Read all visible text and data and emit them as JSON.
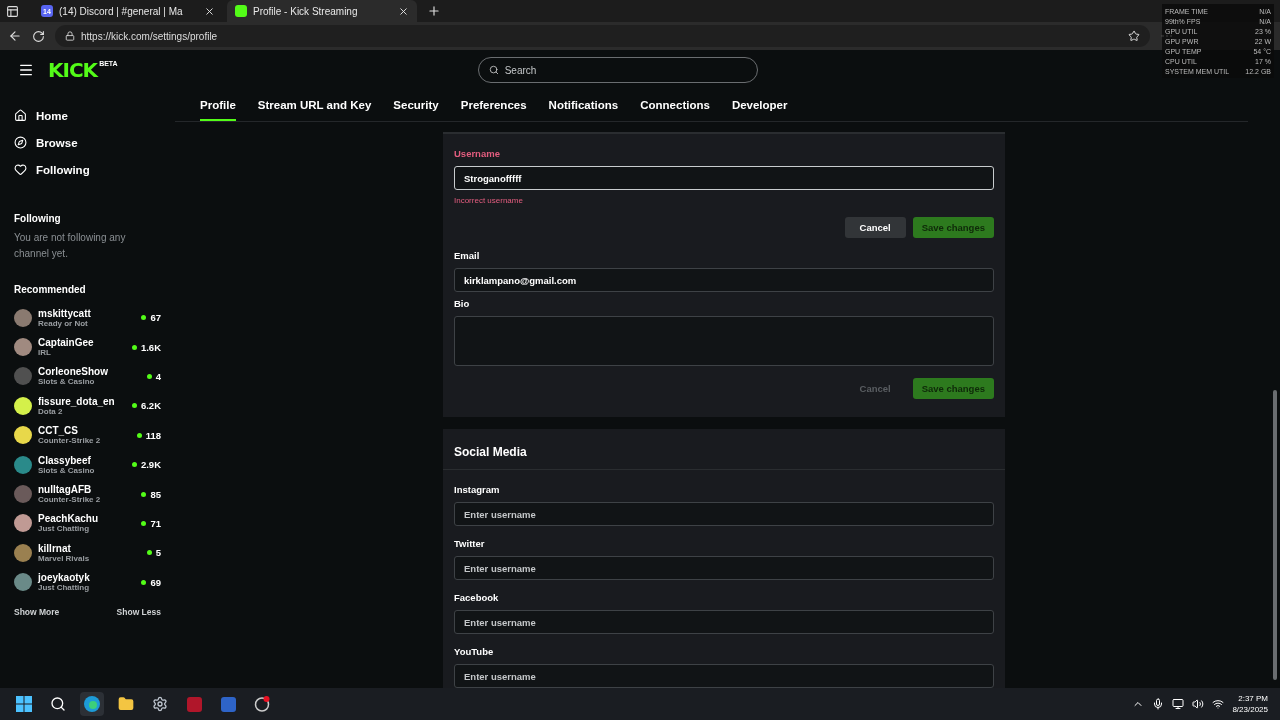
{
  "browser": {
    "tabs": [
      {
        "title": "(14) Discord | #general | Ma",
        "badge": "14",
        "kind": "discord",
        "selected": false
      },
      {
        "title": "Profile - Kick Streaming",
        "kind": "kick",
        "selected": true
      }
    ],
    "url": "https://kick.com/settings/profile"
  },
  "overlay": {
    "rows": [
      {
        "label": "FRAME TIME",
        "value": "N/A"
      },
      {
        "label": "99th% FPS",
        "value": "N/A"
      },
      {
        "label": "GPU UTIL",
        "value": "23 %"
      },
      {
        "label": "GPU PWR",
        "value": "22 W"
      },
      {
        "label": "GPU TEMP",
        "value": "54 °C"
      },
      {
        "label": "CPU UTIL",
        "value": "17 %"
      },
      {
        "label": "SYSTEM MEM UTIL",
        "value": "12.2 GB"
      }
    ]
  },
  "header": {
    "logo": "KICK",
    "logo_tag": "BETA",
    "search": {
      "placeholder": "Search"
    }
  },
  "sidebar": {
    "nav": [
      {
        "label": "Home",
        "kind": "home"
      },
      {
        "label": "Browse",
        "kind": "browse"
      },
      {
        "label": "Following",
        "kind": "heart"
      }
    ],
    "following": {
      "title": "Following",
      "empty": "You are not following any channel yet."
    },
    "recommended": {
      "title": "Recommended",
      "channels": [
        {
          "name": "mskittycatt",
          "category": "Ready or Not",
          "viewers": "67",
          "color": "#8a7a70"
        },
        {
          "name": "CaptainGee",
          "category": "IRL",
          "viewers": "1.6K",
          "color": "#a08a80"
        },
        {
          "name": "CorleoneShow",
          "category": "Slots & Casino",
          "viewers": "4",
          "color": "#505050"
        },
        {
          "name": "fissure_dota_en",
          "category": "Dota 2",
          "viewers": "6.2K",
          "color": "#d4f04a"
        },
        {
          "name": "CCT_CS",
          "category": "Counter-Strike 2",
          "viewers": "118",
          "color": "#e8d84a"
        },
        {
          "name": "Classybeef",
          "category": "Slots & Casino",
          "viewers": "2.9K",
          "color": "#2a8a8a"
        },
        {
          "name": "nulltagAFB",
          "category": "Counter-Strike 2",
          "viewers": "85",
          "color": "#6a5a5a"
        },
        {
          "name": "PeachKachu",
          "category": "Just Chatting",
          "viewers": "71",
          "color": "#c09a94"
        },
        {
          "name": "killrnat",
          "category": "Marvel Rivals",
          "viewers": "5",
          "color": "#9a8050"
        },
        {
          "name": "joeykaotyk",
          "category": "Just Chatting",
          "viewers": "69",
          "color": "#6a8a88"
        }
      ]
    },
    "show_more": "Show More",
    "show_less": "Show Less"
  },
  "settings_tabs": [
    {
      "label": "Profile",
      "selected": true
    },
    {
      "label": "Stream URL and Key",
      "selected": false
    },
    {
      "label": "Security",
      "selected": false
    },
    {
      "label": "Preferences",
      "selected": false
    },
    {
      "label": "Notifications",
      "selected": false
    },
    {
      "label": "Connections",
      "selected": false
    },
    {
      "label": "Developer",
      "selected": false
    }
  ],
  "profile_form": {
    "groups": [
      {
        "fields": [
          {
            "label": "Username",
            "kind": "input",
            "value": "Stroganofffff",
            "error": "Incorrect username"
          }
        ],
        "buttons": [
          {
            "label": "Cancel",
            "kind": "cancel",
            "disabled": false
          },
          {
            "label": "Save changes",
            "kind": "save",
            "disabled": true
          }
        ]
      },
      {
        "fields": [
          {
            "label": "Email",
            "kind": "input",
            "value": "kirklampano@gmail.com"
          },
          {
            "label": "Bio",
            "kind": "textarea"
          }
        ],
        "buttons": [
          {
            "label": "Cancel",
            "kind": "cancel",
            "disabled": true
          },
          {
            "label": "Save changes",
            "kind": "save",
            "disabled": true
          }
        ]
      }
    ]
  },
  "social": {
    "title": "Social Media",
    "fields": [
      {
        "label": "Instagram",
        "placeholder": "Enter username"
      },
      {
        "label": "Twitter",
        "placeholder": "Enter username"
      },
      {
        "label": "Facebook",
        "placeholder": "Enter username"
      },
      {
        "label": "YouTube",
        "placeholder": "Enter username"
      }
    ]
  },
  "taskbar": {
    "apps": [
      {
        "kind": "windows",
        "selected": false
      },
      {
        "kind": "search",
        "selected": false
      },
      {
        "kind": "edge",
        "selected": true
      },
      {
        "kind": "folder",
        "selected": false
      },
      {
        "kind": "settings",
        "selected": false
      },
      {
        "kind": "red",
        "selected": false
      },
      {
        "kind": "r",
        "selected": false
      },
      {
        "kind": "dot",
        "selected": false
      }
    ],
    "time": "2:37 PM",
    "date": "8/23/2025"
  }
}
